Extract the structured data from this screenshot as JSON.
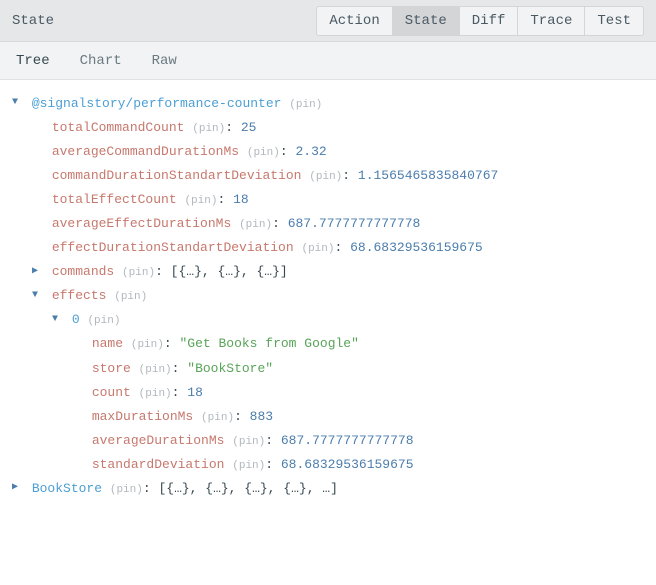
{
  "header": {
    "title": "State",
    "tabs": [
      "Action",
      "State",
      "Diff",
      "Trace",
      "Test"
    ],
    "active_tab": "State"
  },
  "subheader": {
    "tabs": [
      "Tree",
      "Chart",
      "Raw"
    ],
    "active_tab": "Tree"
  },
  "pin_label": "(pin)",
  "tree": {
    "root_key": "@signalstory/performance-counter",
    "totalCommandCount": {
      "key": "totalCommandCount",
      "value": "25"
    },
    "averageCommandDurationMs": {
      "key": "averageCommandDurationMs",
      "value": "2.32"
    },
    "commandDurationStandartDeviation": {
      "key": "commandDurationStandartDeviation",
      "value": "1.1565465835840767"
    },
    "totalEffectCount": {
      "key": "totalEffectCount",
      "value": "18"
    },
    "averageEffectDurationMs": {
      "key": "averageEffectDurationMs",
      "value": "687.7777777777778"
    },
    "effectDurationStandartDeviation": {
      "key": "effectDurationStandartDeviation",
      "value": "68.68329536159675"
    },
    "commands": {
      "key": "commands",
      "preview": "[{…}, {…}, {…}]"
    },
    "effects": {
      "key": "effects"
    },
    "effects_0": {
      "index": "0",
      "name": {
        "key": "name",
        "value": "\"Get Books from Google\""
      },
      "store": {
        "key": "store",
        "value": "\"BookStore\""
      },
      "count": {
        "key": "count",
        "value": "18"
      },
      "maxDurationMs": {
        "key": "maxDurationMs",
        "value": "883"
      },
      "averageDurationMs": {
        "key": "averageDurationMs",
        "value": "687.7777777777778"
      },
      "standardDeviation": {
        "key": "standardDeviation",
        "value": "68.68329536159675"
      }
    },
    "bookstore": {
      "key": "BookStore",
      "preview": "[{…}, {…}, {…}, {…}, …]"
    }
  }
}
